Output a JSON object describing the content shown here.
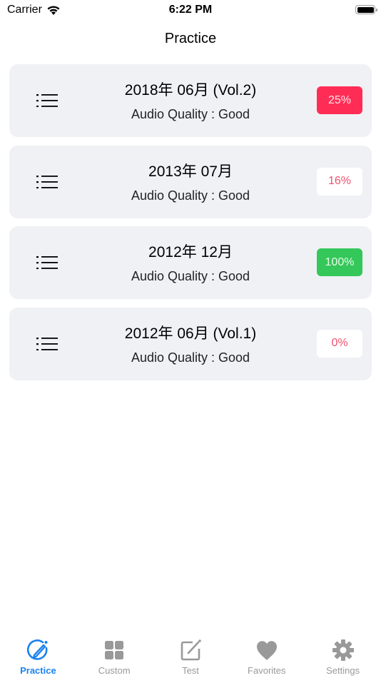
{
  "status_bar": {
    "carrier": "Carrier",
    "time": "6:22 PM"
  },
  "nav": {
    "title": "Practice"
  },
  "items": [
    {
      "title": "2018年 06月 (Vol.2)",
      "subtitle": "Audio Quality : Good",
      "progress": "25%",
      "badge_style": "filled-red"
    },
    {
      "title": "2013年 07月",
      "subtitle": "Audio Quality : Good",
      "progress": "16%",
      "badge_style": "outline-red"
    },
    {
      "title": "2012年 12月",
      "subtitle": "Audio Quality : Good",
      "progress": "100%",
      "badge_style": "filled-green"
    },
    {
      "title": "2012年 06月 (Vol.1)",
      "subtitle": "Audio Quality : Good",
      "progress": "0%",
      "badge_style": "outline-red"
    }
  ],
  "tabs": [
    {
      "label": "Practice",
      "icon": "pencil-circle-icon",
      "active": true
    },
    {
      "label": "Custom",
      "icon": "grid-icon",
      "active": false
    },
    {
      "label": "Test",
      "icon": "square-pencil-icon",
      "active": false
    },
    {
      "label": "Favorites",
      "icon": "heart-icon",
      "active": false
    },
    {
      "label": "Settings",
      "icon": "gear-icon",
      "active": false
    }
  ],
  "colors": {
    "accent": "#1a82f0",
    "inactive": "#999999",
    "red": "#ff2d55",
    "red_text": "#f0506e",
    "green": "#34c759",
    "card_bg": "#f0f1f5"
  }
}
